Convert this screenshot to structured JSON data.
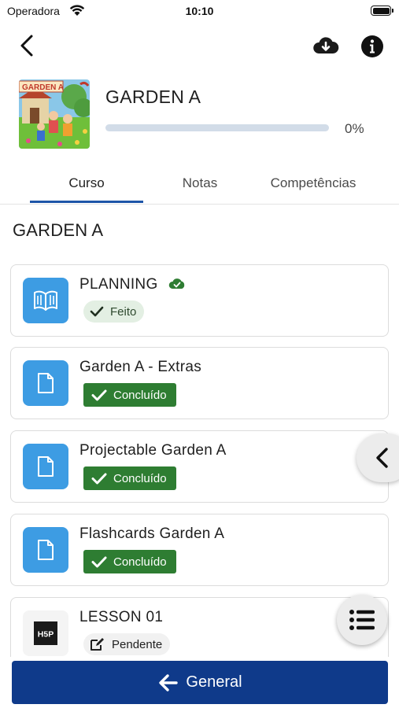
{
  "status_bar": {
    "carrier": "Operadora",
    "time": "10:10"
  },
  "header": {
    "back_icon": "chevron-left-icon",
    "download_icon": "cloud-download-icon",
    "info_icon": "info-circle-icon"
  },
  "course": {
    "title": "GARDEN A",
    "progress_percent": 0,
    "progress_label": "0%",
    "image_banner_text": "GARDEN A"
  },
  "tabs": [
    {
      "label": "Curso",
      "active": true
    },
    {
      "label": "Notas",
      "active": false
    },
    {
      "label": "Competências",
      "active": false
    }
  ],
  "section": {
    "title": "GARDEN A"
  },
  "activities": [
    {
      "title": "PLANNING",
      "icon": "book-icon",
      "status": "Feito",
      "status_type": "feito",
      "synced": true
    },
    {
      "title": "Garden A - Extras",
      "icon": "file-icon",
      "status": "Concluído",
      "status_type": "done"
    },
    {
      "title": "Projectable Garden A",
      "icon": "file-icon",
      "status": "Concluído",
      "status_type": "done"
    },
    {
      "title": "Flashcards Garden A",
      "icon": "file-icon",
      "status": "Concluído",
      "status_type": "done"
    },
    {
      "title": "LESSON 01",
      "icon": "h5p-icon",
      "icon_text": "H5P",
      "status": "Pendente",
      "status_type": "pending"
    }
  ],
  "bottom_nav": {
    "label": "General",
    "icon": "arrow-left-icon"
  },
  "colors": {
    "primary": "#0f3a8a",
    "accent": "#1e55a8",
    "success": "#2e7d32",
    "icon_blue": "#3d9ce3"
  }
}
